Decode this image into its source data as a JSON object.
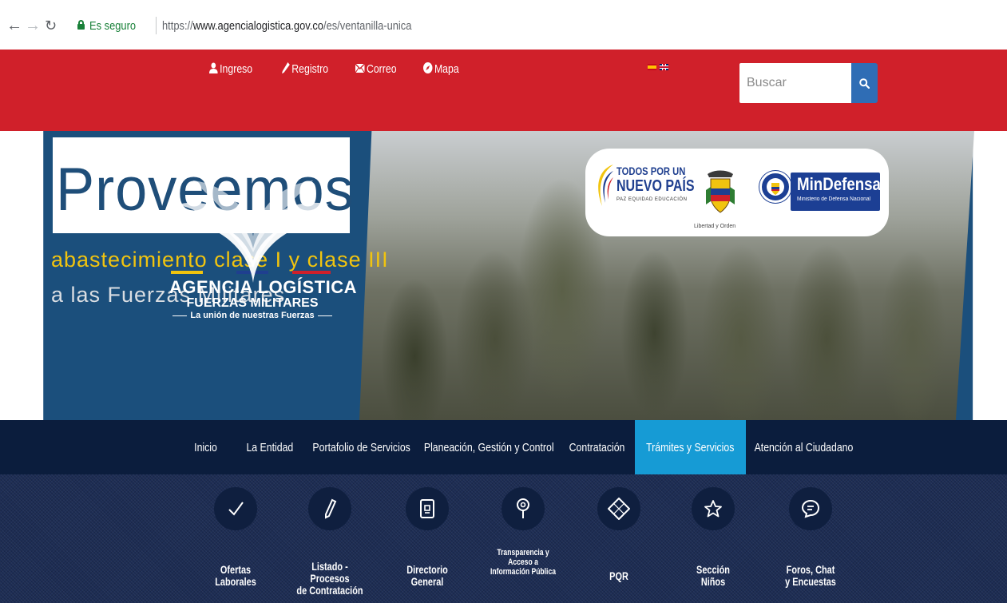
{
  "browser": {
    "secure_label": "Es seguro",
    "url_scheme": "https://",
    "url_host": "www.agencialogistica.gov.co",
    "url_path": "/es/ventanilla-unica"
  },
  "topbar": {
    "links": [
      {
        "label": "Ingreso",
        "icon": "user-icon"
      },
      {
        "label": "Registro",
        "icon": "pencil-icon"
      },
      {
        "label": "Correo",
        "icon": "envelope-icon"
      },
      {
        "label": "Mapa",
        "icon": "compass-icon"
      }
    ],
    "languages": [
      "es-flag",
      "uk-flag"
    ],
    "search": {
      "placeholder": "Buscar",
      "value": ""
    }
  },
  "hero": {
    "title": "Proveemos",
    "subtitle_1": "abastecimiento clase I y clase III",
    "subtitle_2": "a las Fuerzas Militares",
    "logo_line_1": "AGENCIA LOGÍSTICA",
    "logo_line_2": "FUERZAS MILITARES",
    "logo_line_3": "La unión de nuestras Fuerzas",
    "gov_line_1": "TODOS POR UN",
    "gov_line_2": "NUEVO PAÍS",
    "gov_line_3": "PAZ  EQUIDAD  EDUCACIÓN",
    "escudo_caption": "Libertad y Orden",
    "mindef_title": "MinDefensa",
    "mindef_subtitle": "Ministerio de Defensa Nacional"
  },
  "mainnav": {
    "items": [
      {
        "label": "Inicio",
        "active": false
      },
      {
        "label": "La Entidad",
        "active": false
      },
      {
        "label": "Portafolio de Servicios",
        "active": false
      },
      {
        "label": "Planeación, Gestión y Control",
        "active": false
      },
      {
        "label": "Contratación",
        "active": false
      },
      {
        "label": "Trámites y Servicios",
        "active": true
      },
      {
        "label": "Atención al Ciudadano",
        "active": false
      }
    ]
  },
  "services": {
    "items": [
      {
        "label": "Ofertas\nLaborales",
        "icon": "checkmark-icon"
      },
      {
        "label": "Listado - Procesos\nde Contratación",
        "icon": "pencil-icon"
      },
      {
        "label": "Directorio\nGeneral",
        "icon": "contact-card-icon"
      },
      {
        "label": "Transparencia y\nAcceso a\nInformación Pública",
        "icon": "location-pin-icon"
      },
      {
        "label": "PQR",
        "icon": "pqr-diamond-icon"
      },
      {
        "label": "Sección\nNiños",
        "icon": "star-icon"
      },
      {
        "label": "Foros, Chat\ny Encuestas",
        "icon": "chat-bubble-icon"
      }
    ]
  },
  "colors": {
    "topbar_red": "#d0202a",
    "nav_navy": "#0b1d3d",
    "active_blue": "#169bd5",
    "search_blue": "#2f6db5",
    "hero_blue": "#1f4e79"
  }
}
